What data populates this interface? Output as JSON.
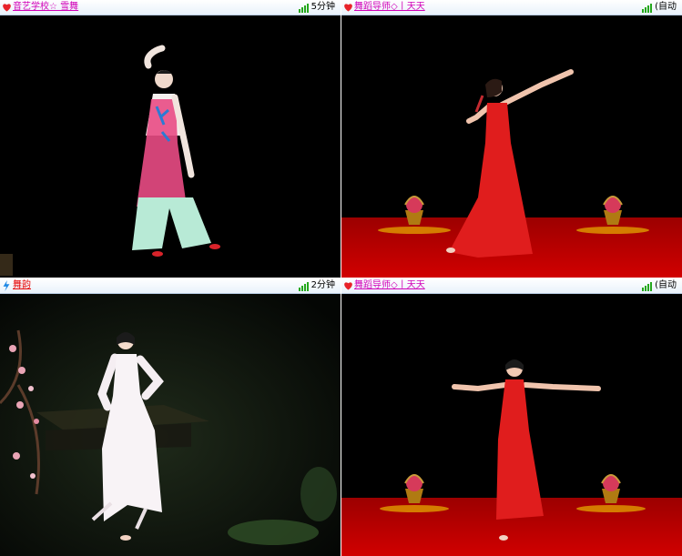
{
  "panels": [
    {
      "lead_icon": "heart-icon",
      "name": "音艺学校☆ 雪舞",
      "name_color": "#d100b8",
      "status": "5分钟",
      "signal_icon": "signal-icon"
    },
    {
      "lead_icon": "heart-icon",
      "name": "舞蹈导师◇丨天天",
      "name_color": "#d100b8",
      "status": "(自动",
      "signal_icon": "signal-icon"
    },
    {
      "lead_icon": "lightning-icon",
      "name": "舞韵",
      "name_color": "#e60000",
      "status": "2分钟",
      "signal_icon": "signal-icon"
    },
    {
      "lead_icon": "heart-icon",
      "name": "舞蹈导师◇丨天天",
      "name_color": "#d100b8",
      "status": "(自动",
      "signal_icon": "signal-icon"
    }
  ],
  "colors": {
    "header_bg": "#e9f2fb",
    "stage_red": "#c80000",
    "signal_green": "#25a81c",
    "heart_red": "#e8232a",
    "lightning_blue": "#1e88e5"
  }
}
